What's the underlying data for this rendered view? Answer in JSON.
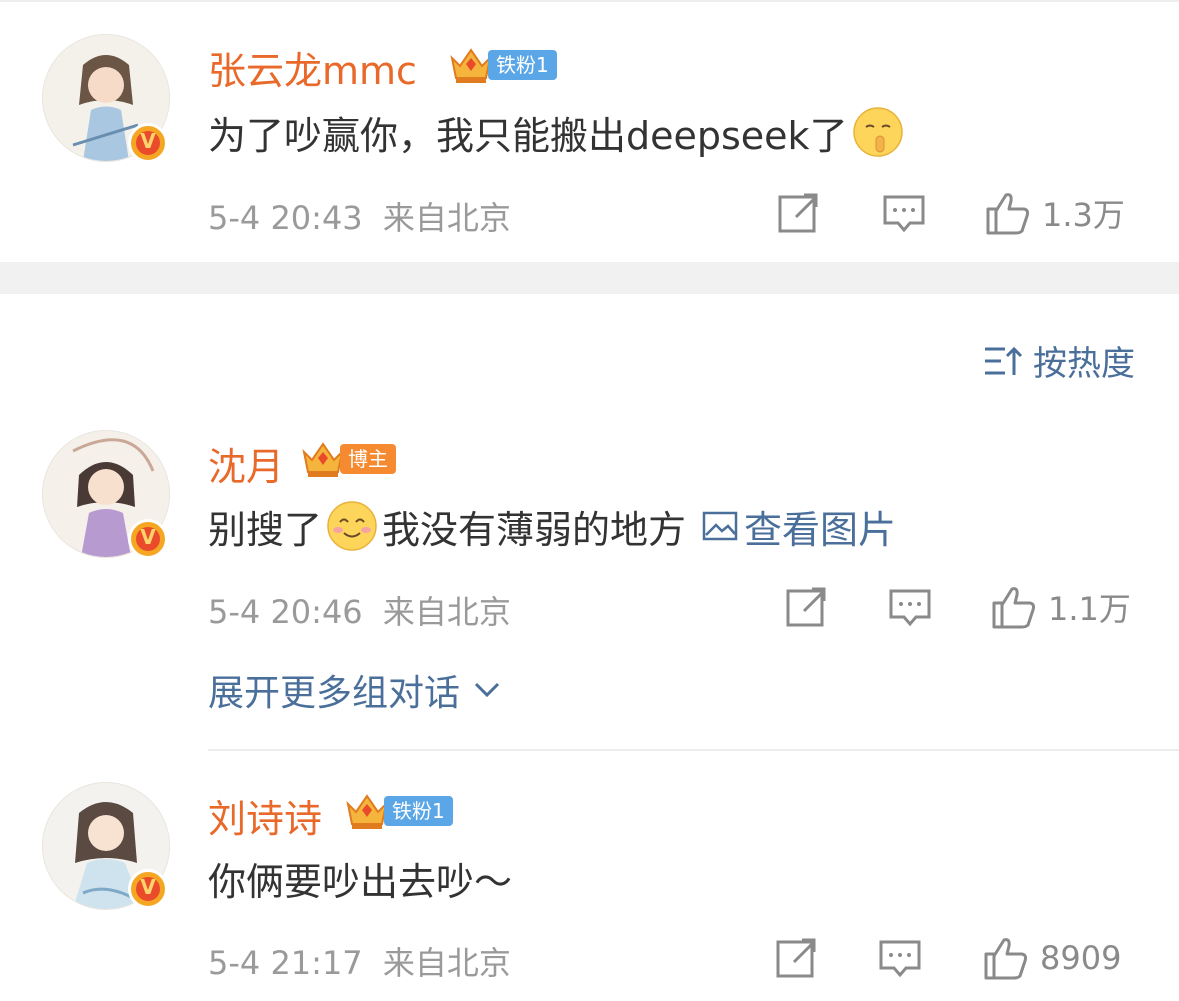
{
  "comments": [
    {
      "name": "张云龙mmc",
      "badge": "铁粉1",
      "text_before": "为了吵赢你，我只能搬出deepseek了",
      "text_after": "",
      "link": "",
      "time": "5-4 20:43",
      "location": "来自北京",
      "likes": "1.3万",
      "verified": "V"
    },
    {
      "name": "沈月",
      "badge": "博主",
      "text_before": "别搜了",
      "text_after": "我没有薄弱的地方",
      "link": "查看图片",
      "time": "5-4 20:46",
      "location": "来自北京",
      "likes": "1.1万",
      "verified": "V"
    },
    {
      "name": "刘诗诗",
      "badge": "铁粉1",
      "text_before": "你俩要吵出去吵～",
      "text_after": "",
      "link": "",
      "time": "5-4 21:17",
      "location": "来自北京",
      "likes": "8909",
      "verified": "V"
    }
  ],
  "sort": {
    "label": "按热度"
  },
  "expand": {
    "label": "展开更多组对话"
  },
  "colors": {
    "name": "#e8692a",
    "link": "#4a6f9a",
    "meta": "#9a9a9a",
    "fan_tag": "#5aa6e6",
    "blogger_tag": "#f58a30"
  },
  "icons": [
    "share-icon",
    "comment-icon",
    "like-icon",
    "sort-icon",
    "chevron-down-icon",
    "image-icon",
    "crown-icon",
    "verified-icon"
  ]
}
